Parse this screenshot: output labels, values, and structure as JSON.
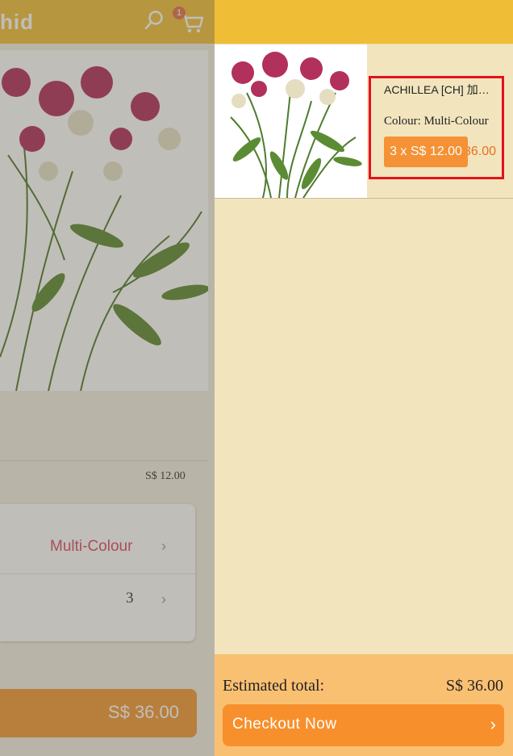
{
  "background_page": {
    "logo_text": "hid",
    "cart_count": "1",
    "unit_price": "S$ 12.00",
    "colour_value": "Multi-Colour",
    "quantity": "3",
    "total_button": "S$ 36.00",
    "icons": [
      "search-icon",
      "cart-icon",
      "chevron-right-icon"
    ]
  },
  "cart": {
    "items": [
      {
        "name": "ACHILLEA [CH] 加…",
        "colour": "Colour: Multi-Colour",
        "qty_price": "3 x S$ 12.00",
        "subtotal": "S$ 36.00"
      }
    ],
    "estimated_label": "Estimated total:",
    "estimated_value": "S$ 36.00",
    "checkout_label": "Checkout Now",
    "checkout_icon": "chevron-right-icon"
  },
  "colors": {
    "header": "#f0bd36",
    "drawer_bg": "#f2e5be",
    "footer_bg": "#fac072",
    "accent": "#f7902c",
    "highlight": "#e4121b"
  }
}
